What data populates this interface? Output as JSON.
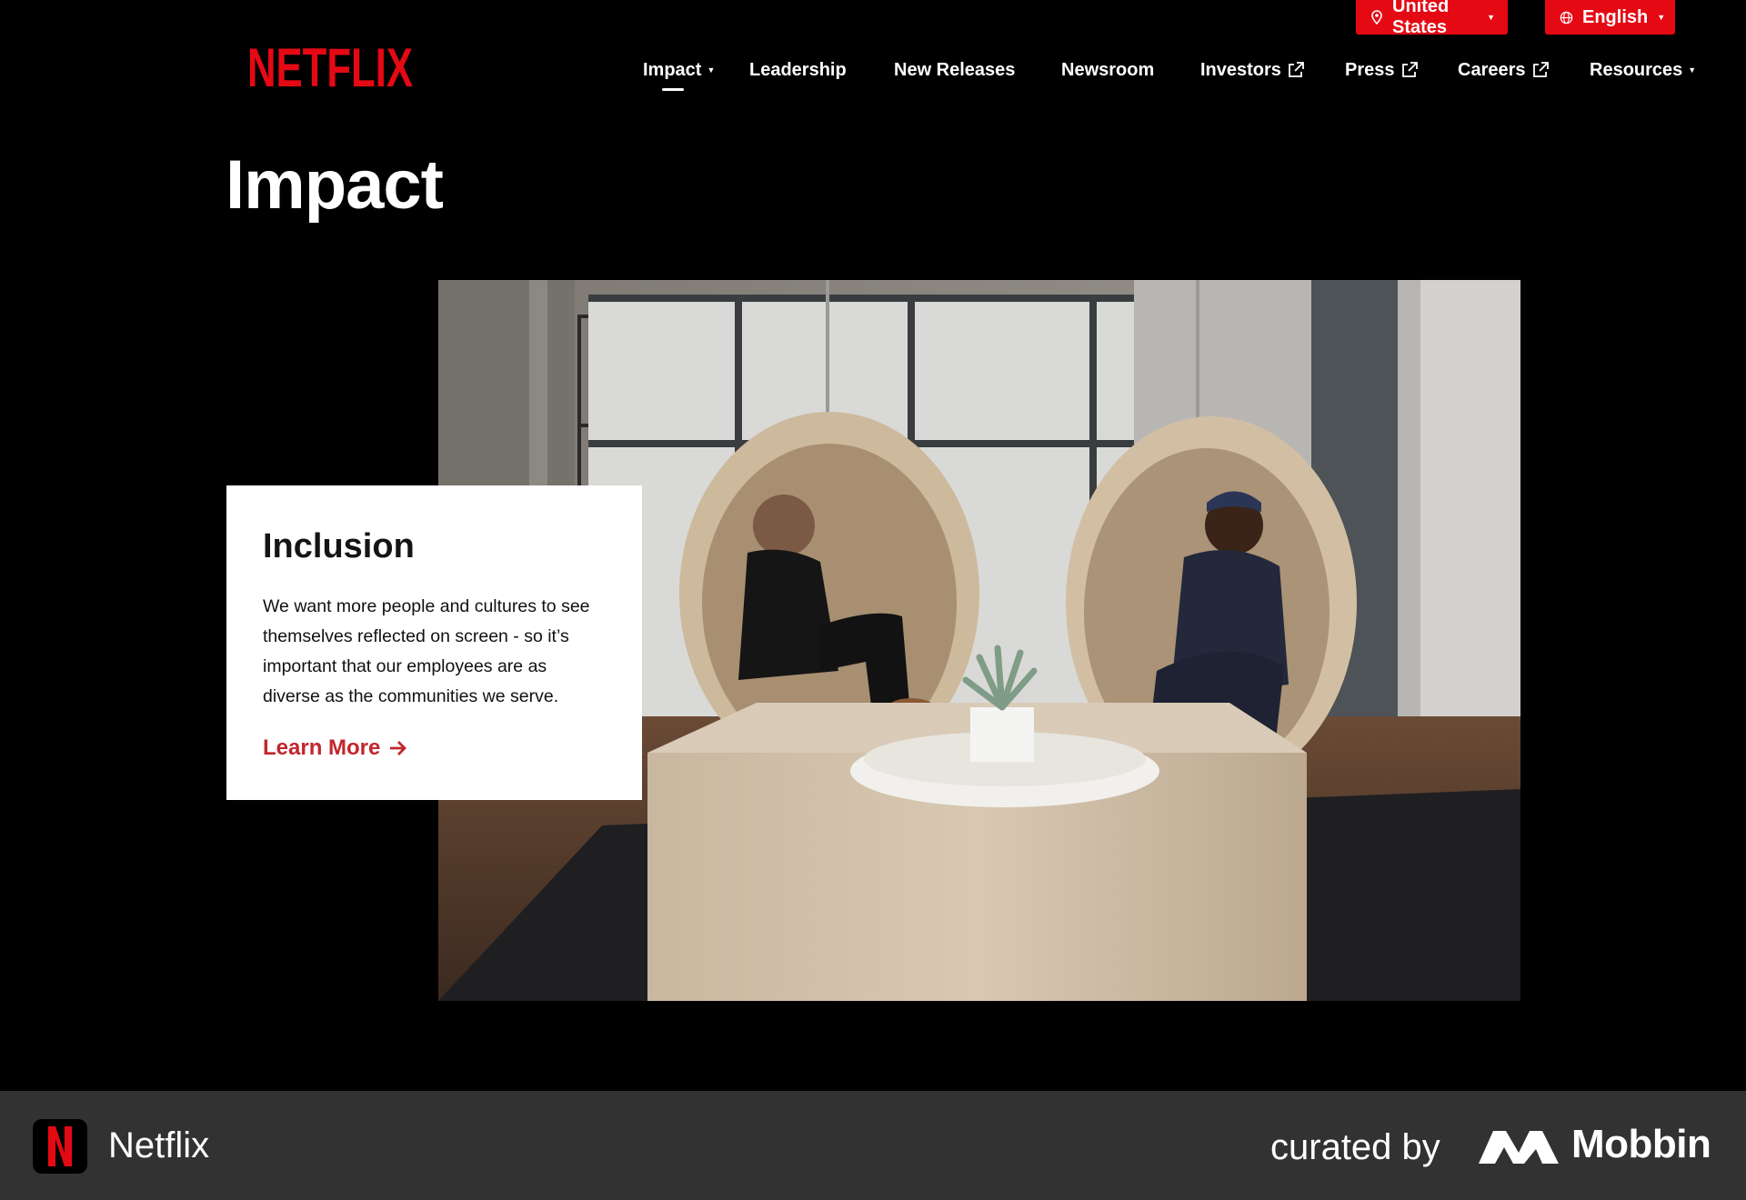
{
  "header": {
    "country_label": "United States",
    "language_label": "English",
    "logo_text": "NETFLIX"
  },
  "nav": {
    "items": [
      {
        "label": "Impact",
        "has_dropdown": true,
        "active": true
      },
      {
        "label": "Leadership"
      },
      {
        "label": "New Releases"
      },
      {
        "label": "Newsroom"
      },
      {
        "label": "Investors",
        "external": true
      },
      {
        "label": "Press",
        "external": true
      },
      {
        "label": "Careers",
        "external": true
      },
      {
        "label": "Resources",
        "has_dropdown": true
      }
    ]
  },
  "page": {
    "title": "Impact"
  },
  "card": {
    "heading": "Inclusion",
    "body": "We want more people and cultures to see themselves reflected on screen - so it’s important that our employees are as diverse as the communities we serve.",
    "link_label": "Learn More"
  },
  "footer": {
    "app_name": "Netflix",
    "curated_by": "curated by",
    "brand": "Mobbin"
  },
  "colors": {
    "netflix_red": "#e50914",
    "link_red": "#c1272d",
    "footer_bg": "#323232"
  }
}
